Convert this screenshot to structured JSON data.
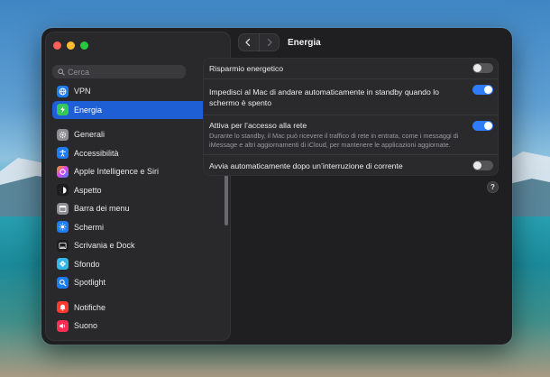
{
  "colors": {
    "accent": "#2f7cf6",
    "sidebar_selected": "#1f5fd6",
    "window_bg": "#1f1f21"
  },
  "search": {
    "placeholder": "Cerca",
    "value": ""
  },
  "sidebar": {
    "items": [
      {
        "label": "VPN",
        "icon": "globe-icon",
        "color": "#1d7cf2",
        "selected": false
      },
      {
        "label": "Energia",
        "icon": "bolt-icon",
        "color": "#34c759",
        "selected": true
      },
      {
        "label": "Generali",
        "icon": "gear-icon",
        "color": "#8e8e93",
        "selected": false
      },
      {
        "label": "Accessibilità",
        "icon": "accessibility-icon",
        "color": "#1d7cf2",
        "selected": false
      },
      {
        "label": "Apple Intelligence e Siri",
        "icon": "siri-icon",
        "color": "#d85cd6",
        "selected": false
      },
      {
        "label": "Aspetto",
        "icon": "appearance-icon",
        "color": "#1c1c1e",
        "selected": false
      },
      {
        "label": "Barra dei menu",
        "icon": "menubar-icon",
        "color": "#8e8e93",
        "selected": false
      },
      {
        "label": "Schermi",
        "icon": "sun-icon",
        "color": "#1d7cf2",
        "selected": false
      },
      {
        "label": "Scrivania e Dock",
        "icon": "dock-icon",
        "color": "#1c1c1e",
        "selected": false
      },
      {
        "label": "Sfondo",
        "icon": "flower-icon",
        "color": "#35b6e8",
        "selected": false
      },
      {
        "label": "Spotlight",
        "icon": "spotlight-icon",
        "color": "#1d7cf2",
        "selected": false
      },
      {
        "label": "Notifiche",
        "icon": "bell-icon",
        "color": "#ff3b30",
        "selected": false
      },
      {
        "label": "Suono",
        "icon": "speaker-icon",
        "color": "#ff2d55",
        "selected": false
      }
    ]
  },
  "header": {
    "title": "Energia"
  },
  "settings": {
    "rows": [
      {
        "title": "Risparmio energetico",
        "subtitle": "",
        "enabled": false
      },
      {
        "title": "Impedisci al Mac di andare automaticamente in standby quando lo schermo è spento",
        "subtitle": "",
        "enabled": true
      },
      {
        "title": "Attiva per l’accesso alla rete",
        "subtitle": "Durante lo standby, il Mac può ricevere il traffico di rete in entrata, come i messaggi di iMessage e altri aggiornamenti di iCloud, per mantenere le applicazioni aggiornate.",
        "enabled": true
      },
      {
        "title": "Avvia automaticamente dopo un’interruzione di corrente",
        "subtitle": "",
        "enabled": false
      }
    ]
  },
  "help": {
    "label": "?"
  }
}
